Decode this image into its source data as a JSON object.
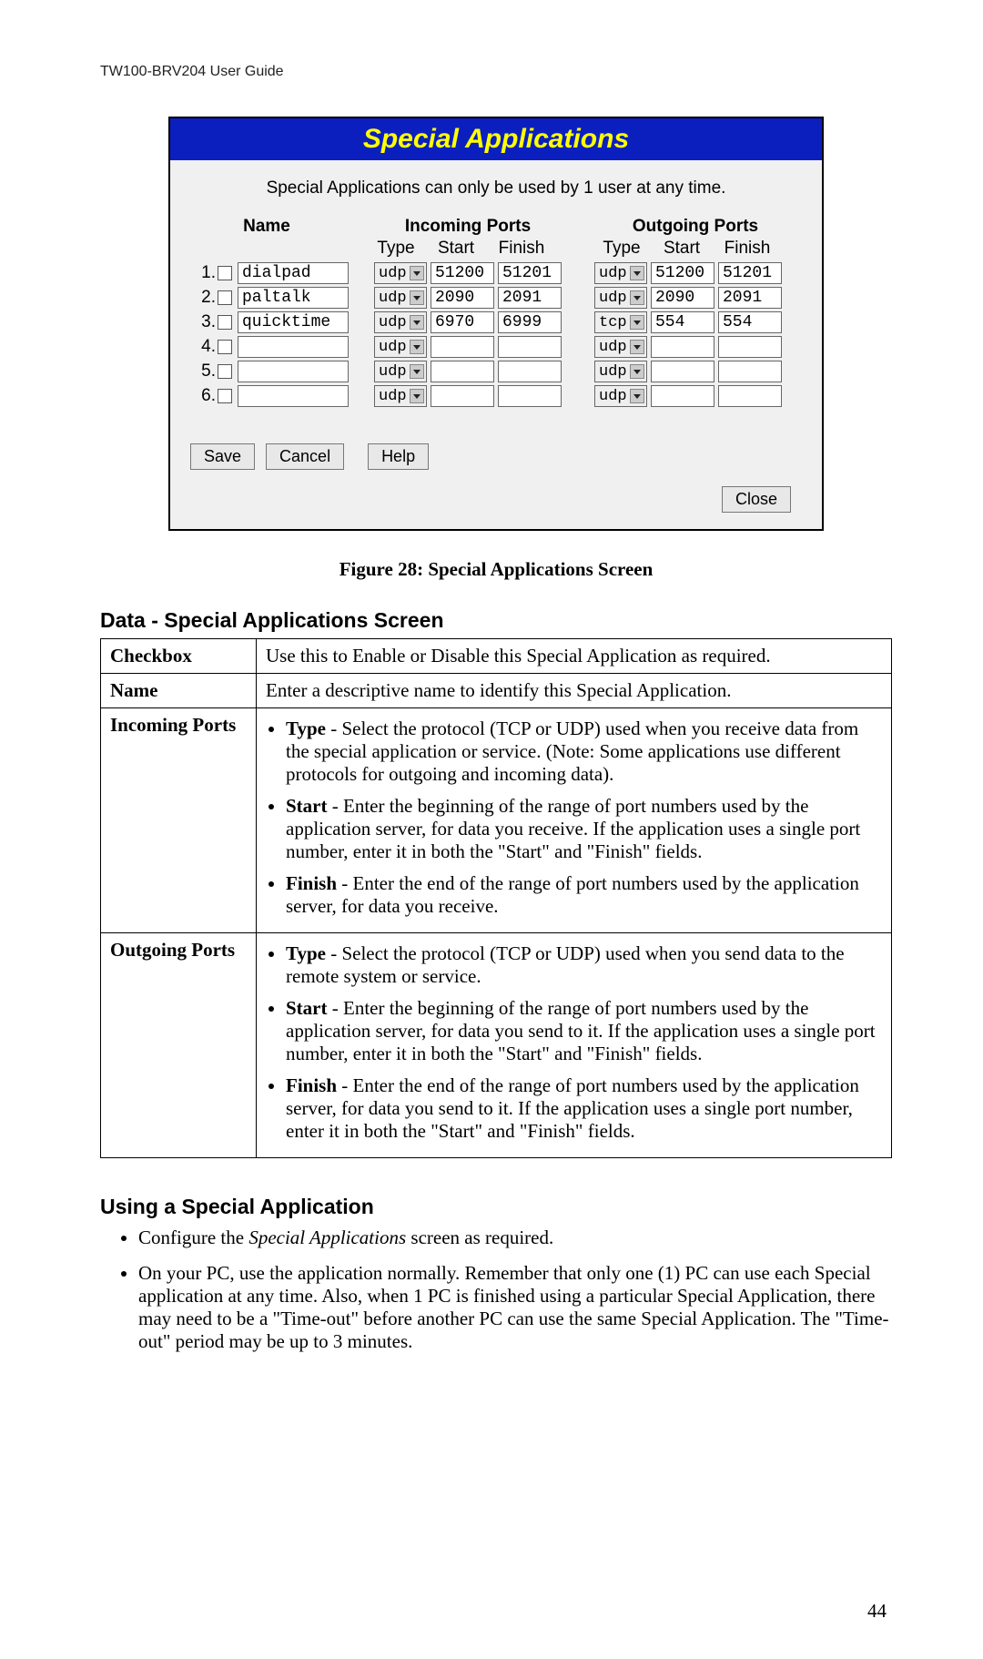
{
  "running_header": "TW100-BRV204 User Guide",
  "panel": {
    "title": "Special Applications",
    "note": "Special Applications can only be used by 1 user at any time.",
    "headers": {
      "name": "Name",
      "incoming": "Incoming Ports",
      "outgoing": "Outgoing Ports",
      "type": "Type",
      "start": "Start",
      "finish": "Finish"
    },
    "rows": [
      {
        "num": "1.",
        "name": "dialpad",
        "in_type": "udp",
        "in_start": "51200",
        "in_finish": "51201",
        "out_type": "udp",
        "out_start": "51200",
        "out_finish": "51201"
      },
      {
        "num": "2.",
        "name": "paltalk",
        "in_type": "udp",
        "in_start": "2090",
        "in_finish": "2091",
        "out_type": "udp",
        "out_start": "2090",
        "out_finish": "2091"
      },
      {
        "num": "3.",
        "name": "quicktime",
        "in_type": "udp",
        "in_start": "6970",
        "in_finish": "6999",
        "out_type": "tcp",
        "out_start": "554",
        "out_finish": "554"
      },
      {
        "num": "4.",
        "name": "",
        "in_type": "udp",
        "in_start": "",
        "in_finish": "",
        "out_type": "udp",
        "out_start": "",
        "out_finish": ""
      },
      {
        "num": "5.",
        "name": "",
        "in_type": "udp",
        "in_start": "",
        "in_finish": "",
        "out_type": "udp",
        "out_start": "",
        "out_finish": ""
      },
      {
        "num": "6.",
        "name": "",
        "in_type": "udp",
        "in_start": "",
        "in_finish": "",
        "out_type": "udp",
        "out_start": "",
        "out_finish": ""
      }
    ],
    "buttons": {
      "save": "Save",
      "cancel": "Cancel",
      "help": "Help",
      "close": "Close"
    }
  },
  "caption": "Figure 28: Special Applications Screen",
  "section1": "Data - Special Applications Screen",
  "table": {
    "checkbox": {
      "label": "Checkbox",
      "text": "Use this to Enable or Disable this Special Application as required."
    },
    "name": {
      "label": "Name",
      "text": "Enter a descriptive name to identify this Special Application."
    },
    "incoming": {
      "label": "Incoming Ports",
      "type_b": "Type",
      "type_t": " - Select the protocol (TCP or UDP) used when you receive data from the special application or service. (Note: Some applications use different protocols for outgoing and incoming data).",
      "start_b": "Start",
      "start_t": " - Enter the beginning of the range of port numbers used by the application server, for data you receive. If the application uses a single port number, enter it in both the \"Start\" and \"Finish\" fields.",
      "finish_b": "Finish",
      "finish_t": " - Enter the end of the range of port numbers used by the application server, for data you receive."
    },
    "outgoing": {
      "label": "Outgoing Ports",
      "type_b": "Type",
      "type_t": " - Select the protocol (TCP or UDP) used when you send data to the remote system or service.",
      "start_b": "Start",
      "start_t": " - Enter the beginning of the range of port numbers used by the application server, for data you send to it. If the application uses a single port number, enter it in both the \"Start\" and \"Finish\" fields.",
      "finish_b": "Finish",
      "finish_t": " - Enter the end of the range of port numbers used by the application server, for data you send to it. If the application uses a single port number, enter it in both the \"Start\" and \"Finish\" fields."
    }
  },
  "section2": "Using a Special Application",
  "usage": {
    "li1_a": "Configure the ",
    "li1_i": "Special Applications",
    "li1_b": " screen as required.",
    "li2": "On your PC, use the application normally. Remember that only one (1) PC can use each Special application at any time. Also, when 1 PC is finished using a particular Special Application, there may need to be a \"Time-out\" before another PC can use the same Special Application. The \"Time-out\" period may be up to 3 minutes."
  },
  "page_num": "44"
}
